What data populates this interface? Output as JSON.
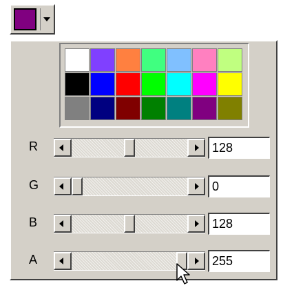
{
  "current_color": "#800080",
  "palette": [
    "#ffffff",
    "#8040ff",
    "#ff8040",
    "#40ff80",
    "#80c0ff",
    "#ff80c0",
    "#c0ff80",
    "#000000",
    "#0000ff",
    "#ff0000",
    "#00ff00",
    "#00ffff",
    "#ff00ff",
    "#ffff00",
    "#808080",
    "#000080",
    "#800000",
    "#008000",
    "#008080",
    "#800080",
    "#808000"
  ],
  "channels": [
    {
      "label": "R",
      "value": "128",
      "level": 0.502
    },
    {
      "label": "G",
      "value": "0",
      "level": 0.0
    },
    {
      "label": "B",
      "value": "128",
      "level": 0.502
    },
    {
      "label": "A",
      "value": "255",
      "level": 1.0
    }
  ],
  "icons": {
    "dropdown": "chevron-down-icon",
    "decrement": "arrow-left-icon",
    "increment": "arrow-right-icon",
    "cursor": "mouse-pointer-icon"
  }
}
